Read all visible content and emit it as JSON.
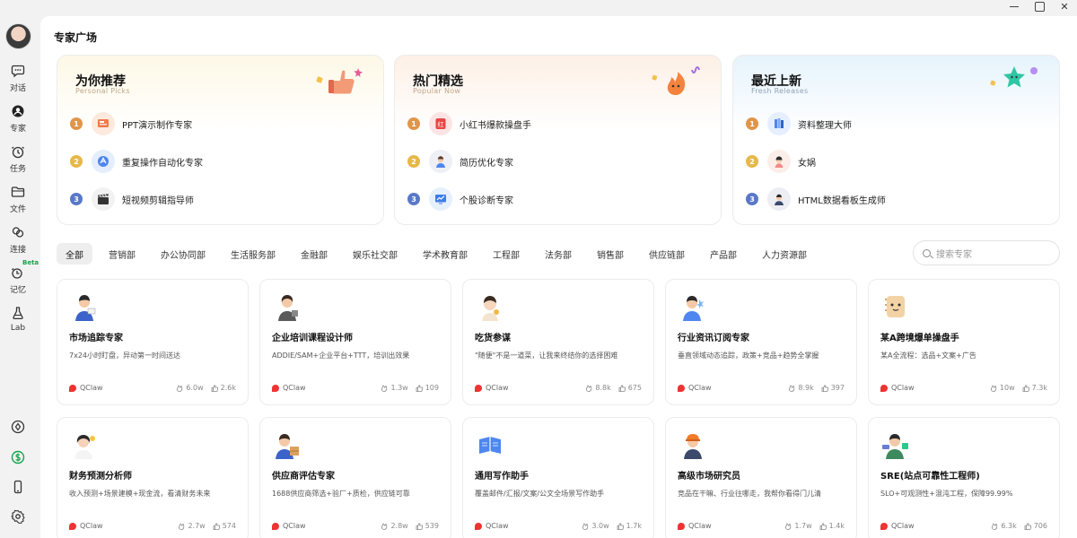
{
  "window": {
    "min": "",
    "max": "",
    "close": "✕"
  },
  "sidebar": {
    "items": [
      {
        "label": "对话",
        "icon": "chat-icon"
      },
      {
        "label": "专家",
        "icon": "expert-icon"
      },
      {
        "label": "任务",
        "icon": "task-clock-icon"
      },
      {
        "label": "文件",
        "icon": "folder-icon"
      },
      {
        "label": "连接",
        "icon": "link-icon"
      },
      {
        "label": "记忆",
        "icon": "memory-icon",
        "badge": "Beta"
      },
      {
        "label": "Lab",
        "icon": "flask-icon"
      }
    ],
    "bottom": [
      "compass-icon",
      "dollar-icon",
      "phone-icon",
      "settings-icon"
    ],
    "accent": "#17a34a"
  },
  "page": {
    "title": "专家广场"
  },
  "featured": [
    {
      "title": "为你推荐",
      "subtitle": "Personal Picks",
      "items": [
        {
          "rank": "1",
          "name": "PPT演示制作专家"
        },
        {
          "rank": "2",
          "name": "重复操作自动化专家"
        },
        {
          "rank": "3",
          "name": "短视频剪辑指导师"
        }
      ]
    },
    {
      "title": "热门精选",
      "subtitle": "Popular Now",
      "items": [
        {
          "rank": "1",
          "name": "小红书爆款操盘手"
        },
        {
          "rank": "2",
          "name": "简历优化专家"
        },
        {
          "rank": "3",
          "name": "个股诊断专家"
        }
      ]
    },
    {
      "title": "最近上新",
      "subtitle": "Fresh Releases",
      "items": [
        {
          "rank": "1",
          "name": "资料整理大师"
        },
        {
          "rank": "2",
          "name": "女娲"
        },
        {
          "rank": "3",
          "name": "HTML数据看板生成师"
        }
      ]
    }
  ],
  "tabs": [
    "全部",
    "营销部",
    "办公协同部",
    "生活服务部",
    "金融部",
    "娱乐社交部",
    "学术教育部",
    "工程部",
    "法务部",
    "销售部",
    "供应链部",
    "产品部",
    "人力资源部"
  ],
  "search": {
    "placeholder": "搜索专家"
  },
  "experts": [
    {
      "name": "市场追踪专家",
      "desc": "7x24小时盯盘，异动第一时间送达",
      "brand": "QClaw",
      "views": "6.0w",
      "likes": "2.6k"
    },
    {
      "name": "企业培训课程设计师",
      "desc": "ADDIE/SAM+企业平台+TTT，培训出效果",
      "brand": "QClaw",
      "views": "1.3w",
      "likes": "109"
    },
    {
      "name": "吃货参谋",
      "desc": "\"随便\"不是一道菜，让我来终结你的选择困难",
      "brand": "QClaw",
      "views": "8.8k",
      "likes": "675"
    },
    {
      "name": "行业资讯订阅专家",
      "desc": "垂直领域动态追踪，政策+竞品+趋势全掌握",
      "brand": "QClaw",
      "views": "8.9k",
      "likes": "397"
    },
    {
      "name": "某A跨境爆单操盘手",
      "desc": "某A全流程：选品+文案+广告",
      "brand": "QClaw",
      "views": "10w",
      "likes": "7.3k"
    },
    {
      "name": "财务预测分析师",
      "desc": "收入预测+场景建模+现金流，看清财务未来",
      "brand": "QClaw",
      "views": "2.7w",
      "likes": "574"
    },
    {
      "name": "供应商评估专家",
      "desc": "1688供应商筛选+验厂+质检，供应链可靠",
      "brand": "QClaw",
      "views": "2.8w",
      "likes": "539"
    },
    {
      "name": "通用写作助手",
      "desc": "覆盖邮件/汇报/文案/公文全场景写作助手",
      "brand": "QClaw",
      "views": "3.0w",
      "likes": "1.7k"
    },
    {
      "name": "高级市场研究员",
      "desc": "竞品在干嘛、行业往哪走，我帮你看得门儿清",
      "brand": "QClaw",
      "views": "1.7w",
      "likes": "1.4k"
    },
    {
      "name": "SRE(站点可靠性工程师)",
      "desc": "SLO+可观测性+混沌工程，保障99.99%",
      "brand": "QClaw",
      "views": "6.3k",
      "likes": "706"
    }
  ]
}
